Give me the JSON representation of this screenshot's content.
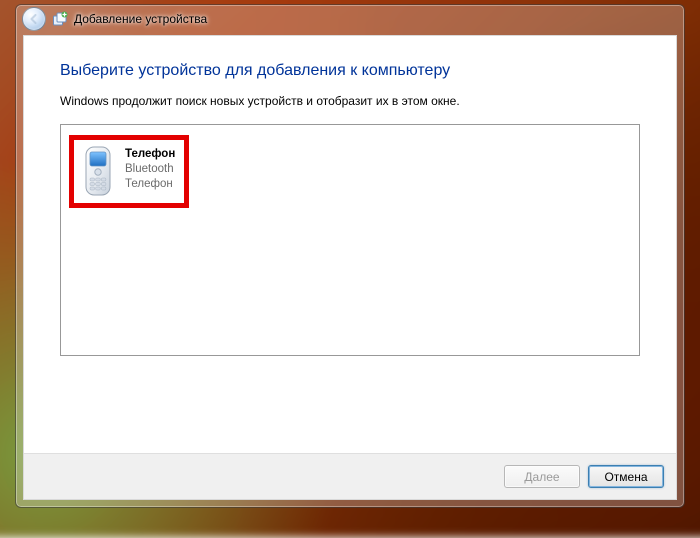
{
  "window": {
    "title": "Добавление устройства"
  },
  "content": {
    "heading": "Выберите устройство для добавления к компьютеру",
    "subtext": "Windows продолжит поиск новых устройств и отобразит их в этом окне."
  },
  "devices": [
    {
      "name": "Телефон",
      "type": "Bluetooth",
      "category": "Телефон",
      "icon": "phone-icon",
      "highlighted": true
    }
  ],
  "footer": {
    "next_label": "Далее",
    "cancel_label": "Отмена",
    "next_enabled": false
  }
}
